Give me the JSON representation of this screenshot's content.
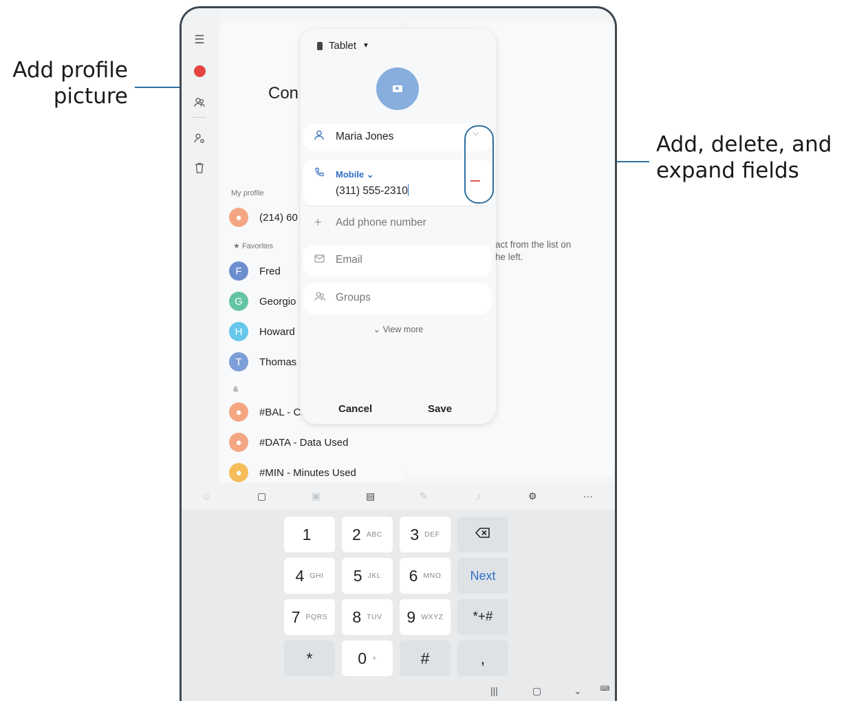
{
  "callouts": {
    "left_line1": "Add profile",
    "left_line2": "picture",
    "right_line1": "Add, delete, and",
    "right_line2": "expand fields"
  },
  "contacts_app": {
    "title_partial": "Con",
    "my_profile_label": "My profile",
    "my_profile_number": "(214) 60",
    "favorites_label": "Favorites",
    "favorites": [
      {
        "initial": "F",
        "name": "Fred",
        "color": "#6d8fd0"
      },
      {
        "initial": "G",
        "name": "Georgio",
        "color": "#63c4a4"
      },
      {
        "initial": "H",
        "name": "Howard",
        "color": "#66c7ea"
      },
      {
        "initial": "T",
        "name": "Thomas",
        "color": "#7d9fd8"
      }
    ],
    "group_label": "&",
    "group_contacts": [
      {
        "name": "#BAL - C.",
        "color": "#f4a683"
      },
      {
        "name": "#DATA - Data Used",
        "color": "#f4a683"
      },
      {
        "name": "#MIN - Minutes Used",
        "color": "#f4bd5a"
      }
    ],
    "detail_hint_line1": "act from the list on",
    "detail_hint_line2": "he left."
  },
  "dialog": {
    "account_label": "Tablet",
    "name_value": "Maria Jones",
    "phone_type": "Mobile",
    "phone_value": "(311) 555-2310",
    "add_phone_placeholder": "Add phone number",
    "email_placeholder": "Email",
    "groups_placeholder": "Groups",
    "view_more": "View more",
    "cancel": "Cancel",
    "save": "Save"
  },
  "keyboard": {
    "keys": [
      {
        "main": "1",
        "sub": ""
      },
      {
        "main": "2",
        "sub": "ABC"
      },
      {
        "main": "3",
        "sub": "DEF"
      },
      {
        "main": "4",
        "sub": "GHI"
      },
      {
        "main": "5",
        "sub": "JKL"
      },
      {
        "main": "6",
        "sub": "MNO"
      },
      {
        "main": "7",
        "sub": "PQRS"
      },
      {
        "main": "8",
        "sub": "TUV"
      },
      {
        "main": "9",
        "sub": "WXYZ"
      },
      {
        "main": "*",
        "sub": ""
      },
      {
        "main": "0",
        "sub": "+"
      },
      {
        "main": "#",
        "sub": ""
      }
    ],
    "next_label": "Next",
    "symbols_label": "*+#",
    "comma_label": ","
  },
  "colors": {
    "accent_blue": "#2f6fc6",
    "callout_line": "#2f6f9f",
    "remove_red": "#e0514f"
  }
}
